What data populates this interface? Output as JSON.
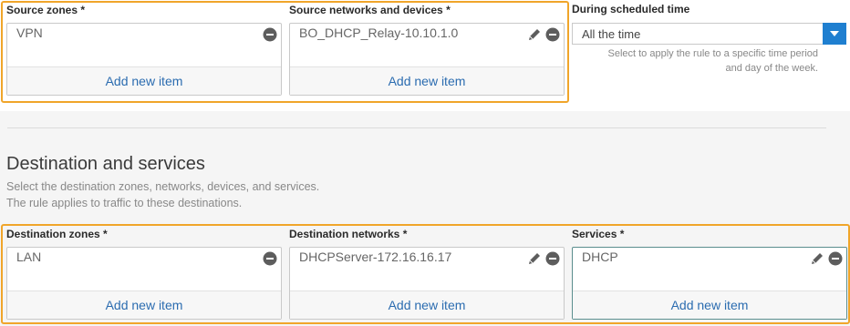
{
  "source": {
    "zones": {
      "label": "Source zones *",
      "items": [
        "VPN"
      ],
      "add_label": "Add new item"
    },
    "networks": {
      "label": "Source networks and devices *",
      "items": [
        "BO_DHCP_Relay-10.10.1.0"
      ],
      "add_label": "Add new item"
    }
  },
  "schedule": {
    "label": "During scheduled time",
    "value": "All the time",
    "help_line1": "Select to apply the rule to a specific time period",
    "help_line2": "and day of the week."
  },
  "destination": {
    "title": "Destination and services",
    "desc_line1": "Select the destination zones, networks, devices, and services.",
    "desc_line2": "The rule applies to traffic to these destinations.",
    "zones": {
      "label": "Destination zones *",
      "items": [
        "LAN"
      ],
      "add_label": "Add new item"
    },
    "networks": {
      "label": "Destination networks *",
      "items": [
        "DHCPServer-172.16.16.17"
      ],
      "add_label": "Add new item"
    },
    "services": {
      "label": "Services *",
      "items": [
        "DHCP"
      ],
      "add_label": "Add new item"
    }
  },
  "colors": {
    "accent": "#1f7fd0",
    "highlight": "#f0a52a",
    "link": "#2b6cb0"
  }
}
